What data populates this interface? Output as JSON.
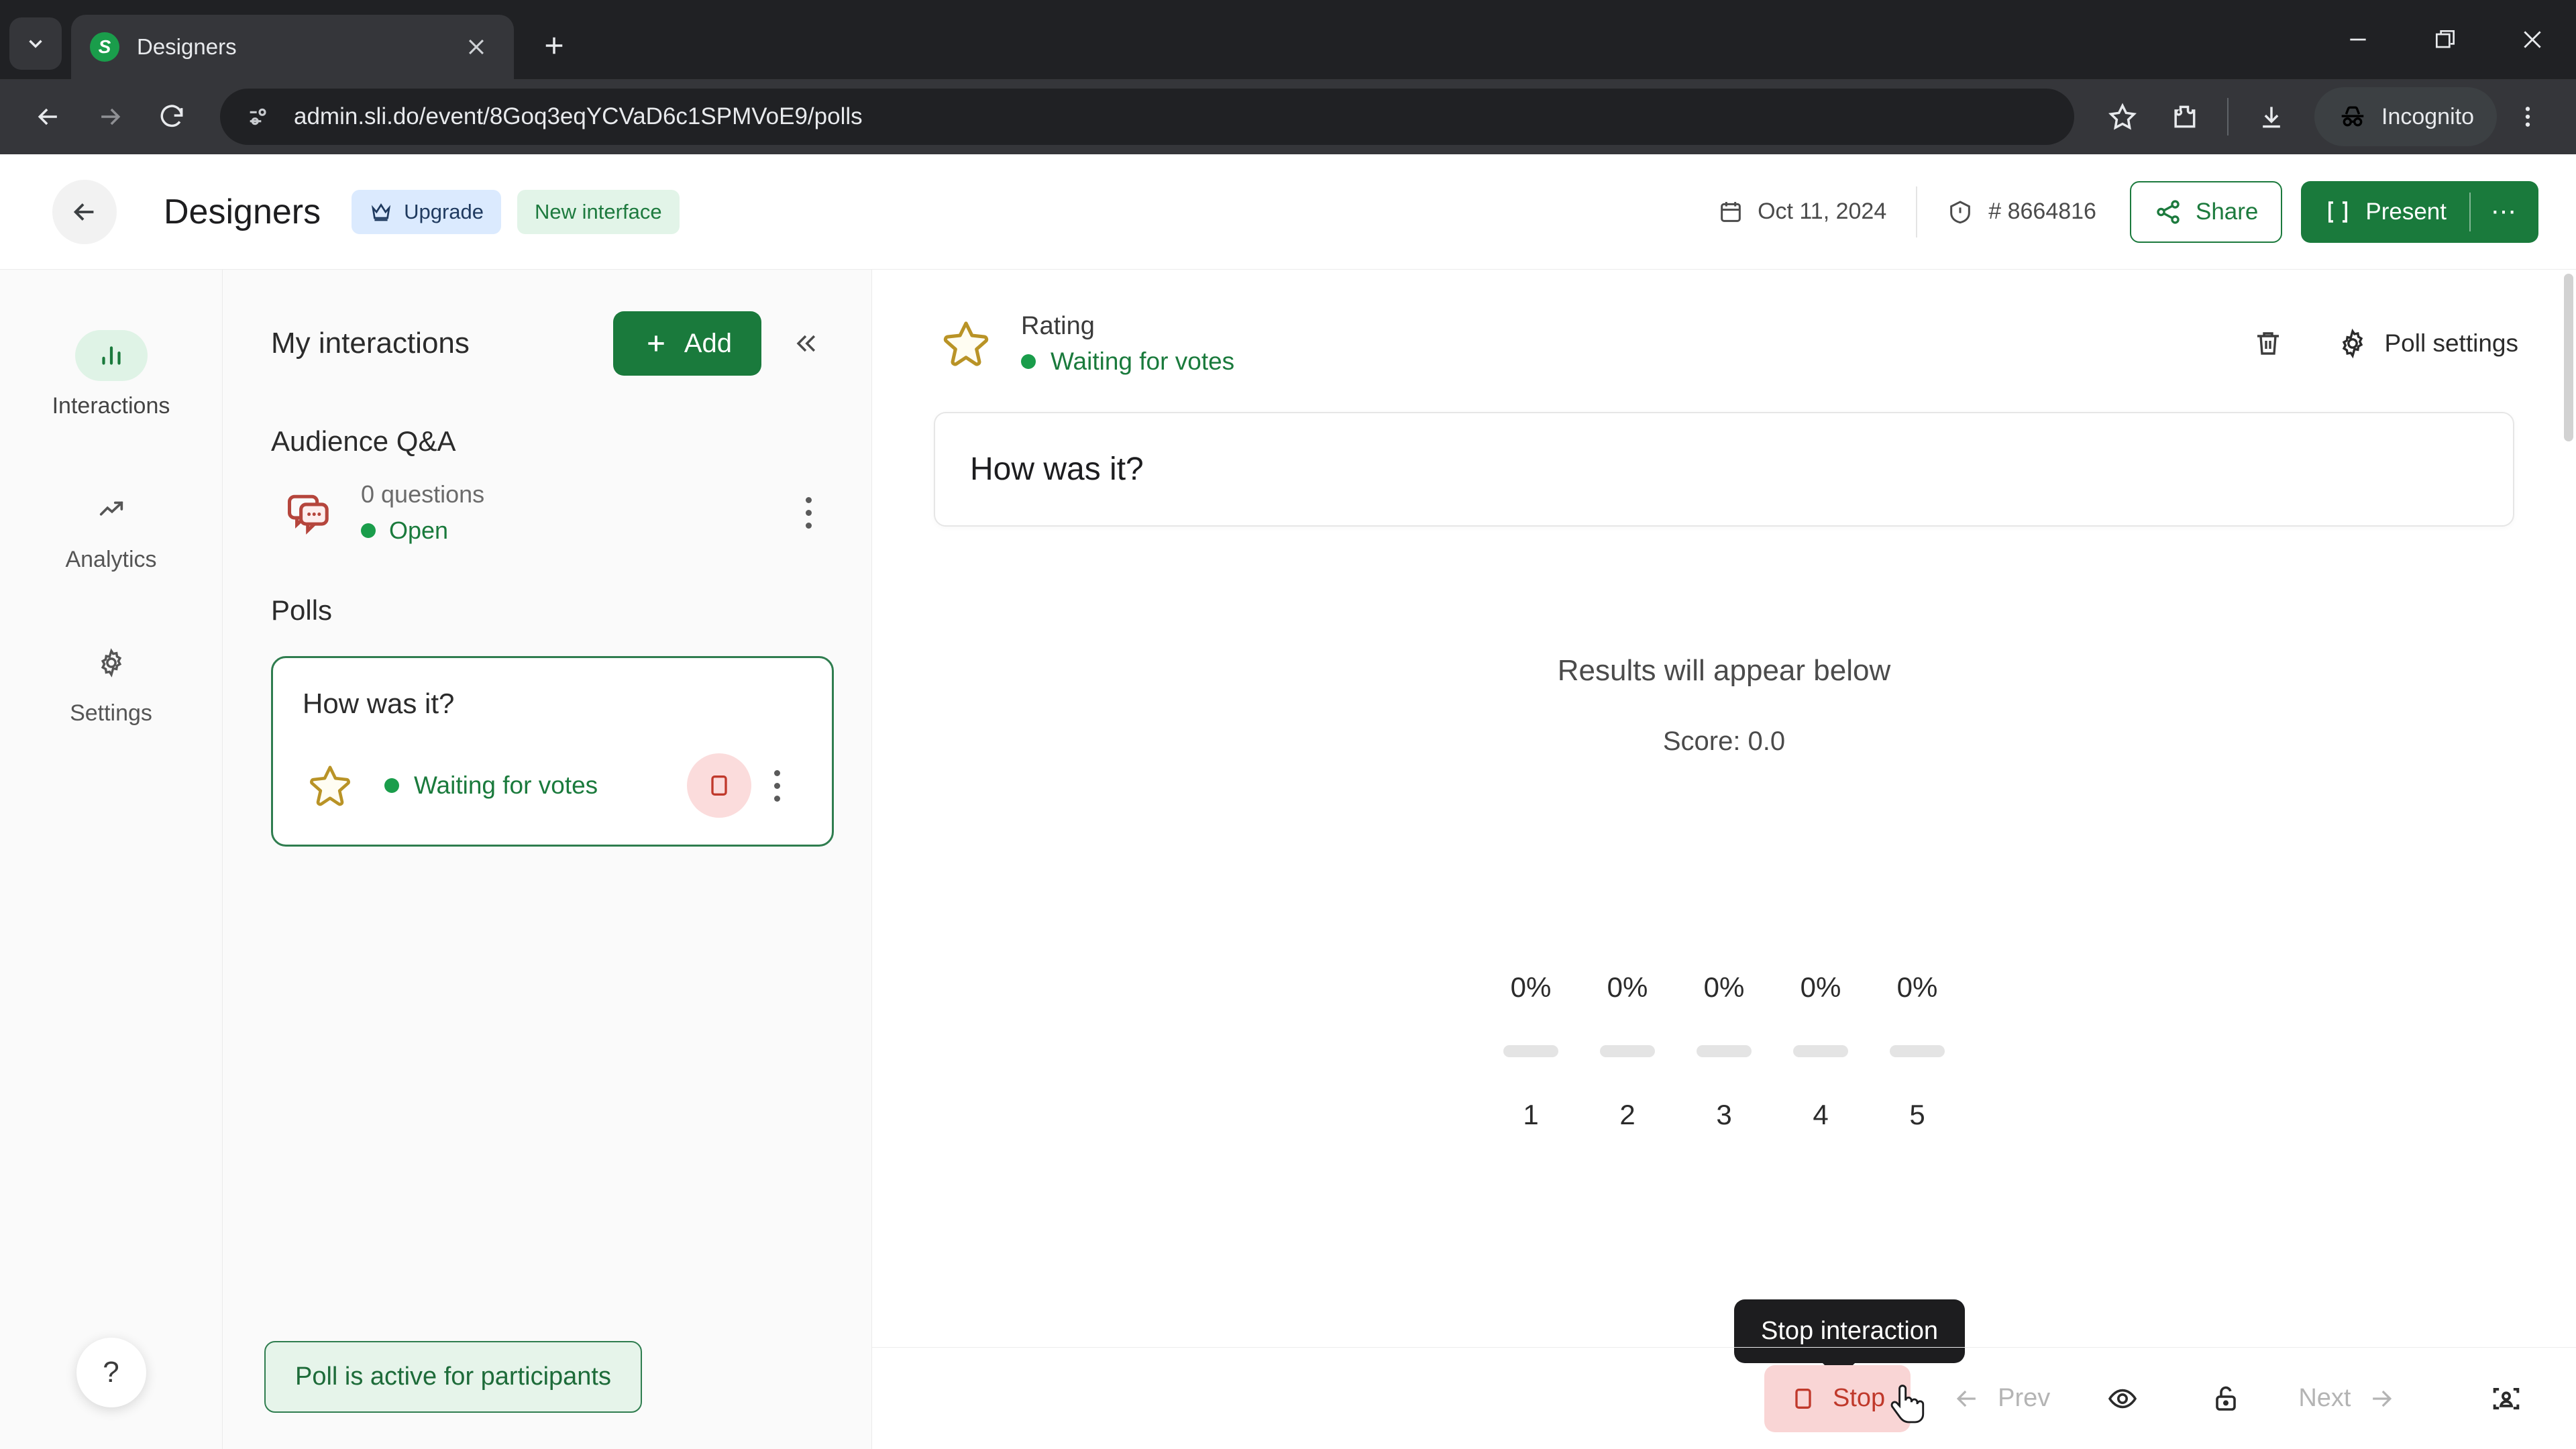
{
  "browser": {
    "tab": {
      "title": "Designers",
      "favicon_letter": "S",
      "favicon_icon": "slido-logo-icon",
      "close_icon": "close-icon"
    },
    "tab_list_icon": "chevron-down-icon",
    "new_tab_icon": "plus-icon",
    "window": {
      "minimize_icon": "minimize-icon",
      "maximize_icon": "restore-icon",
      "close_icon": "close-icon"
    },
    "nav": {
      "back_icon": "arrow-left-icon",
      "forward_icon": "arrow-right-icon",
      "reload_icon": "reload-icon"
    },
    "omnibox": {
      "site_info_icon": "site-settings-icon",
      "url": "admin.sli.do/event/8Goq3eqYCVaD6c1SPMVoE9/polls"
    },
    "actions": {
      "bookmark_icon": "star-icon",
      "extensions_icon": "extensions-puzzle-icon",
      "download_icon": "download-icon",
      "incognito_label": "Incognito",
      "incognito_icon": "incognito-hat-icon",
      "menu_icon": "kebab-menu-icon"
    }
  },
  "header": {
    "back_icon": "arrow-left-icon",
    "title": "Designers",
    "upgrade_badge": {
      "label": "Upgrade",
      "icon": "crown-icon"
    },
    "new_interface_badge": {
      "label": "New interface"
    },
    "date": {
      "label": "Oct 11, 2024",
      "icon": "calendar-icon"
    },
    "event_code": {
      "label": "# 8664816",
      "icon": "info-circle-icon"
    },
    "share_button": {
      "label": "Share",
      "icon": "share-nodes-icon"
    },
    "present_button": {
      "label": "Present",
      "icon": "present-frame-icon",
      "more_label": "⋯"
    }
  },
  "rail": {
    "items": [
      {
        "label": "Interactions",
        "icon": "bar-chart-icon",
        "active": true
      },
      {
        "label": "Analytics",
        "icon": "trending-up-icon",
        "active": false
      },
      {
        "label": "Settings",
        "icon": "gear-icon",
        "active": false
      }
    ],
    "help_label": "?"
  },
  "panel": {
    "title": "My interactions",
    "add_button": {
      "label": "Add",
      "icon": "plus-icon"
    },
    "collapse_icon": "chevron-double-left-icon",
    "qa_section": {
      "title": "Audience Q&A",
      "icon": "chat-bubbles-icon",
      "count": "0 questions",
      "status": "Open",
      "menu_icon": "kebab-menu-icon"
    },
    "polls_section": {
      "title": "Polls",
      "card": {
        "question": "How was it?",
        "icon": "star-outline-icon",
        "status": "Waiting for votes",
        "stop_icon": "stop-square-icon",
        "menu_icon": "kebab-menu-icon"
      }
    },
    "toast": "Poll is active for participants"
  },
  "main": {
    "poll_type": "Rating",
    "poll_type_icon": "star-outline-icon",
    "poll_status": "Waiting for votes",
    "delete_icon": "trash-icon",
    "settings": {
      "label": "Poll settings",
      "icon": "gear-icon"
    },
    "question_value": "How was it?",
    "results_title": "Results will appear below",
    "score_label": "Score: 0.0"
  },
  "chart_data": {
    "type": "bar",
    "title": "Results will appear below",
    "categories": [
      "1",
      "2",
      "3",
      "4",
      "5"
    ],
    "values": [
      0,
      0,
      0,
      0,
      0
    ],
    "value_labels": [
      "0%",
      "0%",
      "0%",
      "0%",
      "0%"
    ],
    "score": "0.0",
    "xlabel": "",
    "ylabel": "",
    "ylim": [
      0,
      100
    ],
    "grid": false,
    "legend": "none"
  },
  "bottom_bar": {
    "stop_button": {
      "label": "Stop",
      "icon": "stop-square-icon"
    },
    "prev_button": {
      "label": "Prev",
      "icon": "arrow-left-icon"
    },
    "next_button": {
      "label": "Next",
      "icon": "arrow-right-icon"
    },
    "preview_icon": "eye-icon",
    "lock_icon": "unlock-icon",
    "participant_view_icon": "participant-frame-icon",
    "tooltip": "Stop interaction"
  }
}
